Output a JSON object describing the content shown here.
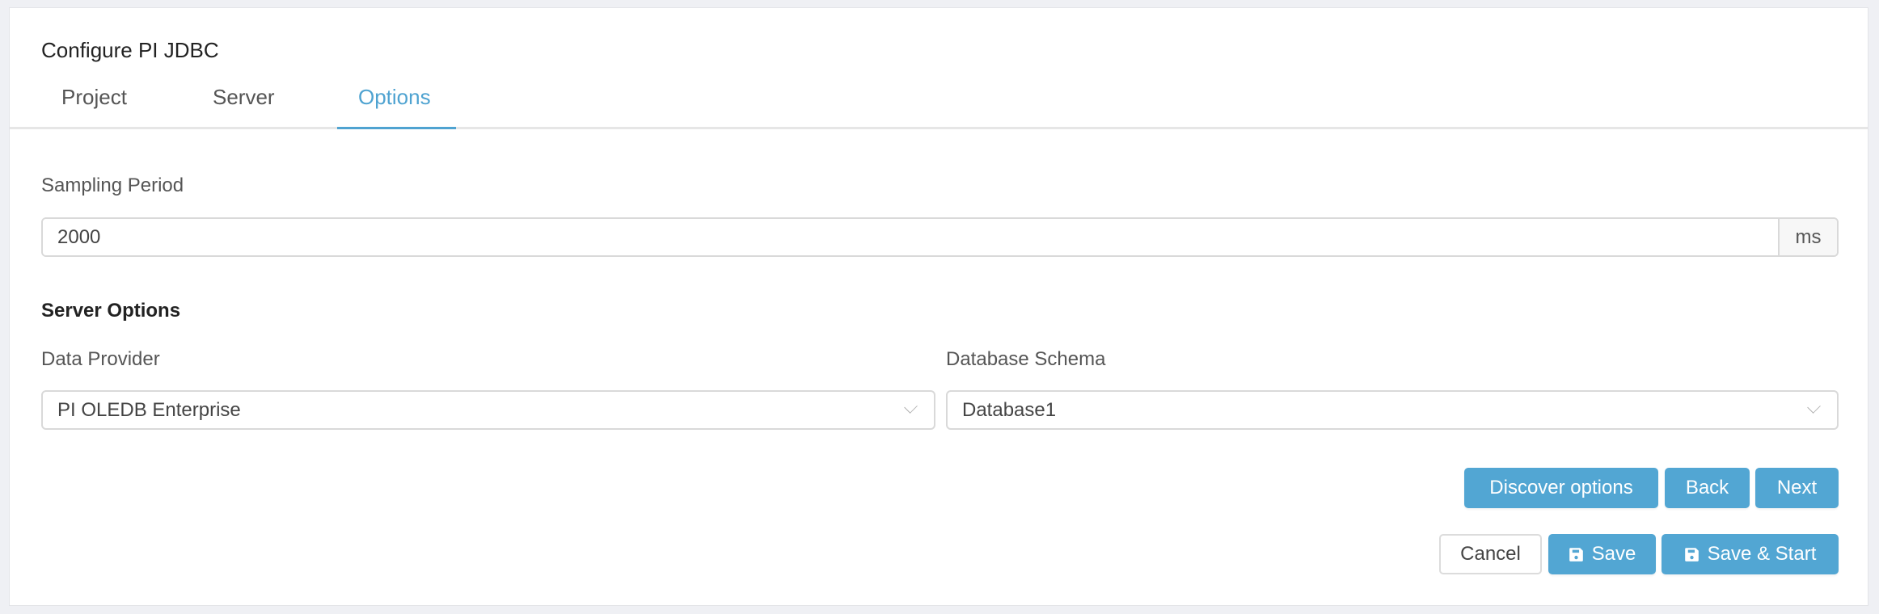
{
  "header": {
    "title": "Configure PI JDBC"
  },
  "tabs": [
    {
      "label": "Project",
      "active": false
    },
    {
      "label": "Server",
      "active": false
    },
    {
      "label": "Options",
      "active": true
    }
  ],
  "sampling": {
    "label": "Sampling Period",
    "value": "2000",
    "unit": "ms"
  },
  "server_options": {
    "heading": "Server Options",
    "data_provider": {
      "label": "Data Provider",
      "value": "PI OLEDB Enterprise"
    },
    "database_schema": {
      "label": "Database Schema",
      "value": "Database1"
    }
  },
  "actions": {
    "discover": "Discover options",
    "back": "Back",
    "next": "Next",
    "cancel": "Cancel",
    "save": "Save",
    "save_start": "Save & Start"
  },
  "colors": {
    "accent": "#52a6d3",
    "background": "#eff0f4"
  }
}
